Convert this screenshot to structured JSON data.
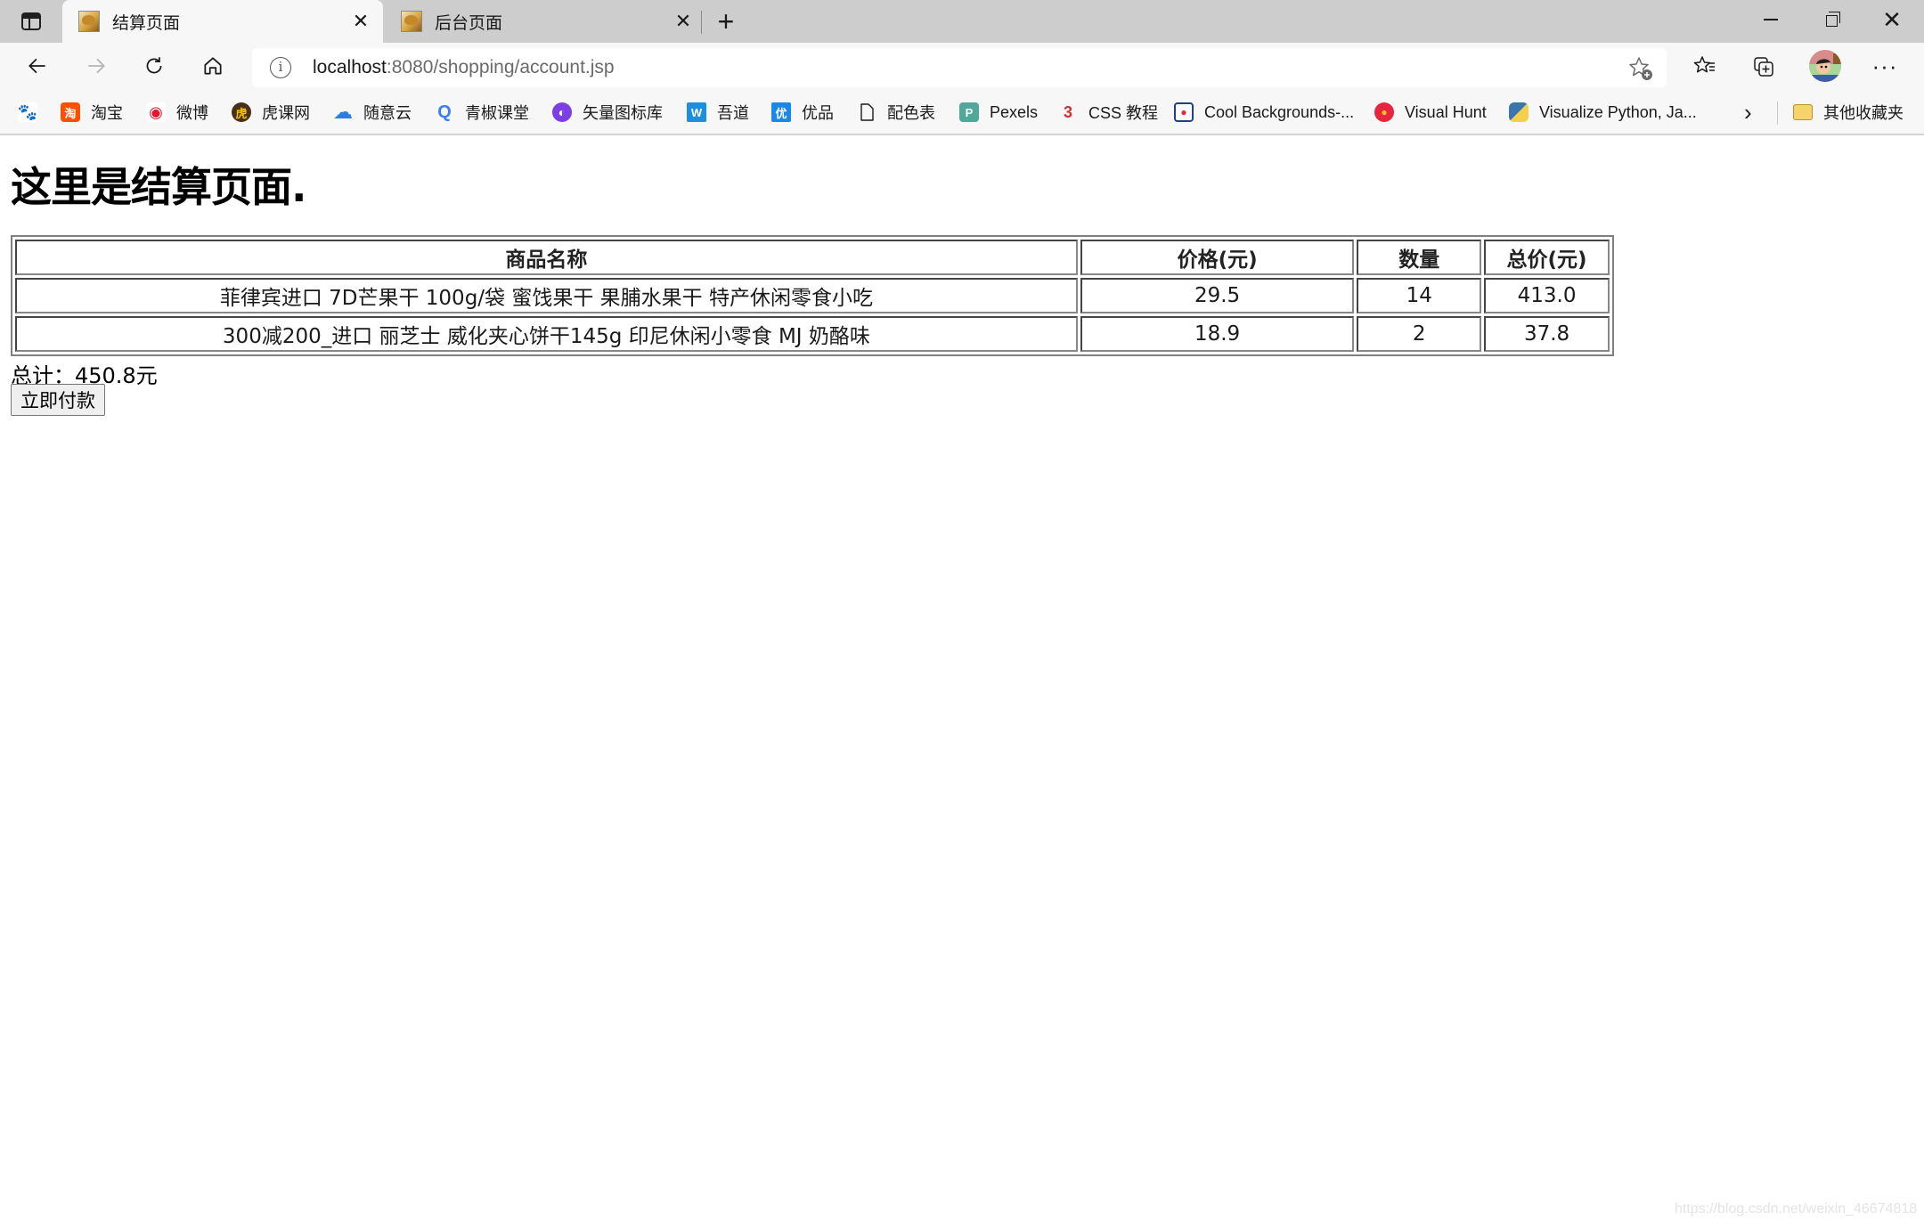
{
  "browser": {
    "tabs": [
      {
        "title": "结算页面",
        "active": true
      },
      {
        "title": "后台页面",
        "active": false
      }
    ],
    "new_tab_label": "+",
    "close_glyph": "✕",
    "window_controls": {
      "close_glyph": "✕"
    },
    "address_bar": {
      "host": "localhost",
      "rest": ":8080/shopping/account.jsp"
    },
    "toolbar_icons": [
      "back-icon",
      "forward-icon",
      "refresh-icon",
      "home-icon",
      "site-info-icon",
      "add-favorite-icon",
      "favorites-icon",
      "collections-icon",
      "profile-avatar",
      "more-icon"
    ],
    "bookmarks": [
      {
        "label": "",
        "icon": "baidu-icon",
        "color": "#2a32e0",
        "glyph": "du"
      },
      {
        "label": "淘宝",
        "icon": "taobao-icon",
        "color": "#ff5000",
        "glyph": "淘"
      },
      {
        "label": "微博",
        "icon": "weibo-icon",
        "color": "#e6162d",
        "glyph": "◉"
      },
      {
        "label": "虎课网",
        "icon": "huke-icon",
        "color": "#4a2f1a",
        "glyph": "虎"
      },
      {
        "label": "随意云",
        "icon": "cloud-icon",
        "color": "#2b7fe0",
        "glyph": "☁"
      },
      {
        "label": "青椒课堂",
        "icon": "qingjiao-icon",
        "color": "#3f7cf5",
        "glyph": "Q"
      },
      {
        "label": "矢量图标库",
        "icon": "iconfont-icon",
        "color": "#7b3fe4",
        "glyph": "◐"
      },
      {
        "label": "吾道",
        "icon": "wudao-icon",
        "color": "#1e8fe0",
        "glyph": "W"
      },
      {
        "label": "优品",
        "icon": "youpin-icon",
        "color": "#1a88e6",
        "glyph": "优"
      },
      {
        "label": "配色表",
        "icon": "page-icon",
        "color": "#ffffff",
        "glyph": ""
      },
      {
        "label": "Pexels",
        "icon": "pexels-icon",
        "color": "#4fa89a",
        "glyph": "P"
      },
      {
        "label": "CSS 教程",
        "icon": "css-icon",
        "color": "#d32f2f",
        "glyph": "3"
      },
      {
        "label": "Cool Backgrounds-...",
        "icon": "cool-backgrounds-icon",
        "color": "#1f3f8a",
        "glyph": "●"
      },
      {
        "label": "Visual Hunt",
        "icon": "visual-hunt-icon",
        "color": "#e8253f",
        "glyph": "●"
      },
      {
        "label": "Visualize Python, Ja...",
        "icon": "python-icon",
        "color": "#3a75b0",
        "glyph": "P"
      }
    ],
    "bookmarks_overflow_glyph": "›",
    "other_favorites": {
      "label": "其他收藏夹",
      "icon": "folder-icon",
      "color": "#f6d36b"
    }
  },
  "page": {
    "heading": "这里是结算页面.",
    "table": {
      "headers": [
        "商品名称",
        "价格(元)",
        "数量",
        "总价(元)"
      ],
      "rows": [
        [
          "菲律宾进口 7D芒果干 100g/袋 蜜饯果干 果脯水果干 特产休闲零食小吃",
          "29.5",
          "14",
          "413.0"
        ],
        [
          "300减200_进口 丽芝士 威化夹心饼干145g 印尼休闲小零食 MJ 奶酪味",
          "18.9",
          "2",
          "37.8"
        ]
      ]
    },
    "total_text": "总计：450.8元",
    "pay_button": "立即付款"
  },
  "watermark": "https://blog.csdn.net/weixin_46674818"
}
